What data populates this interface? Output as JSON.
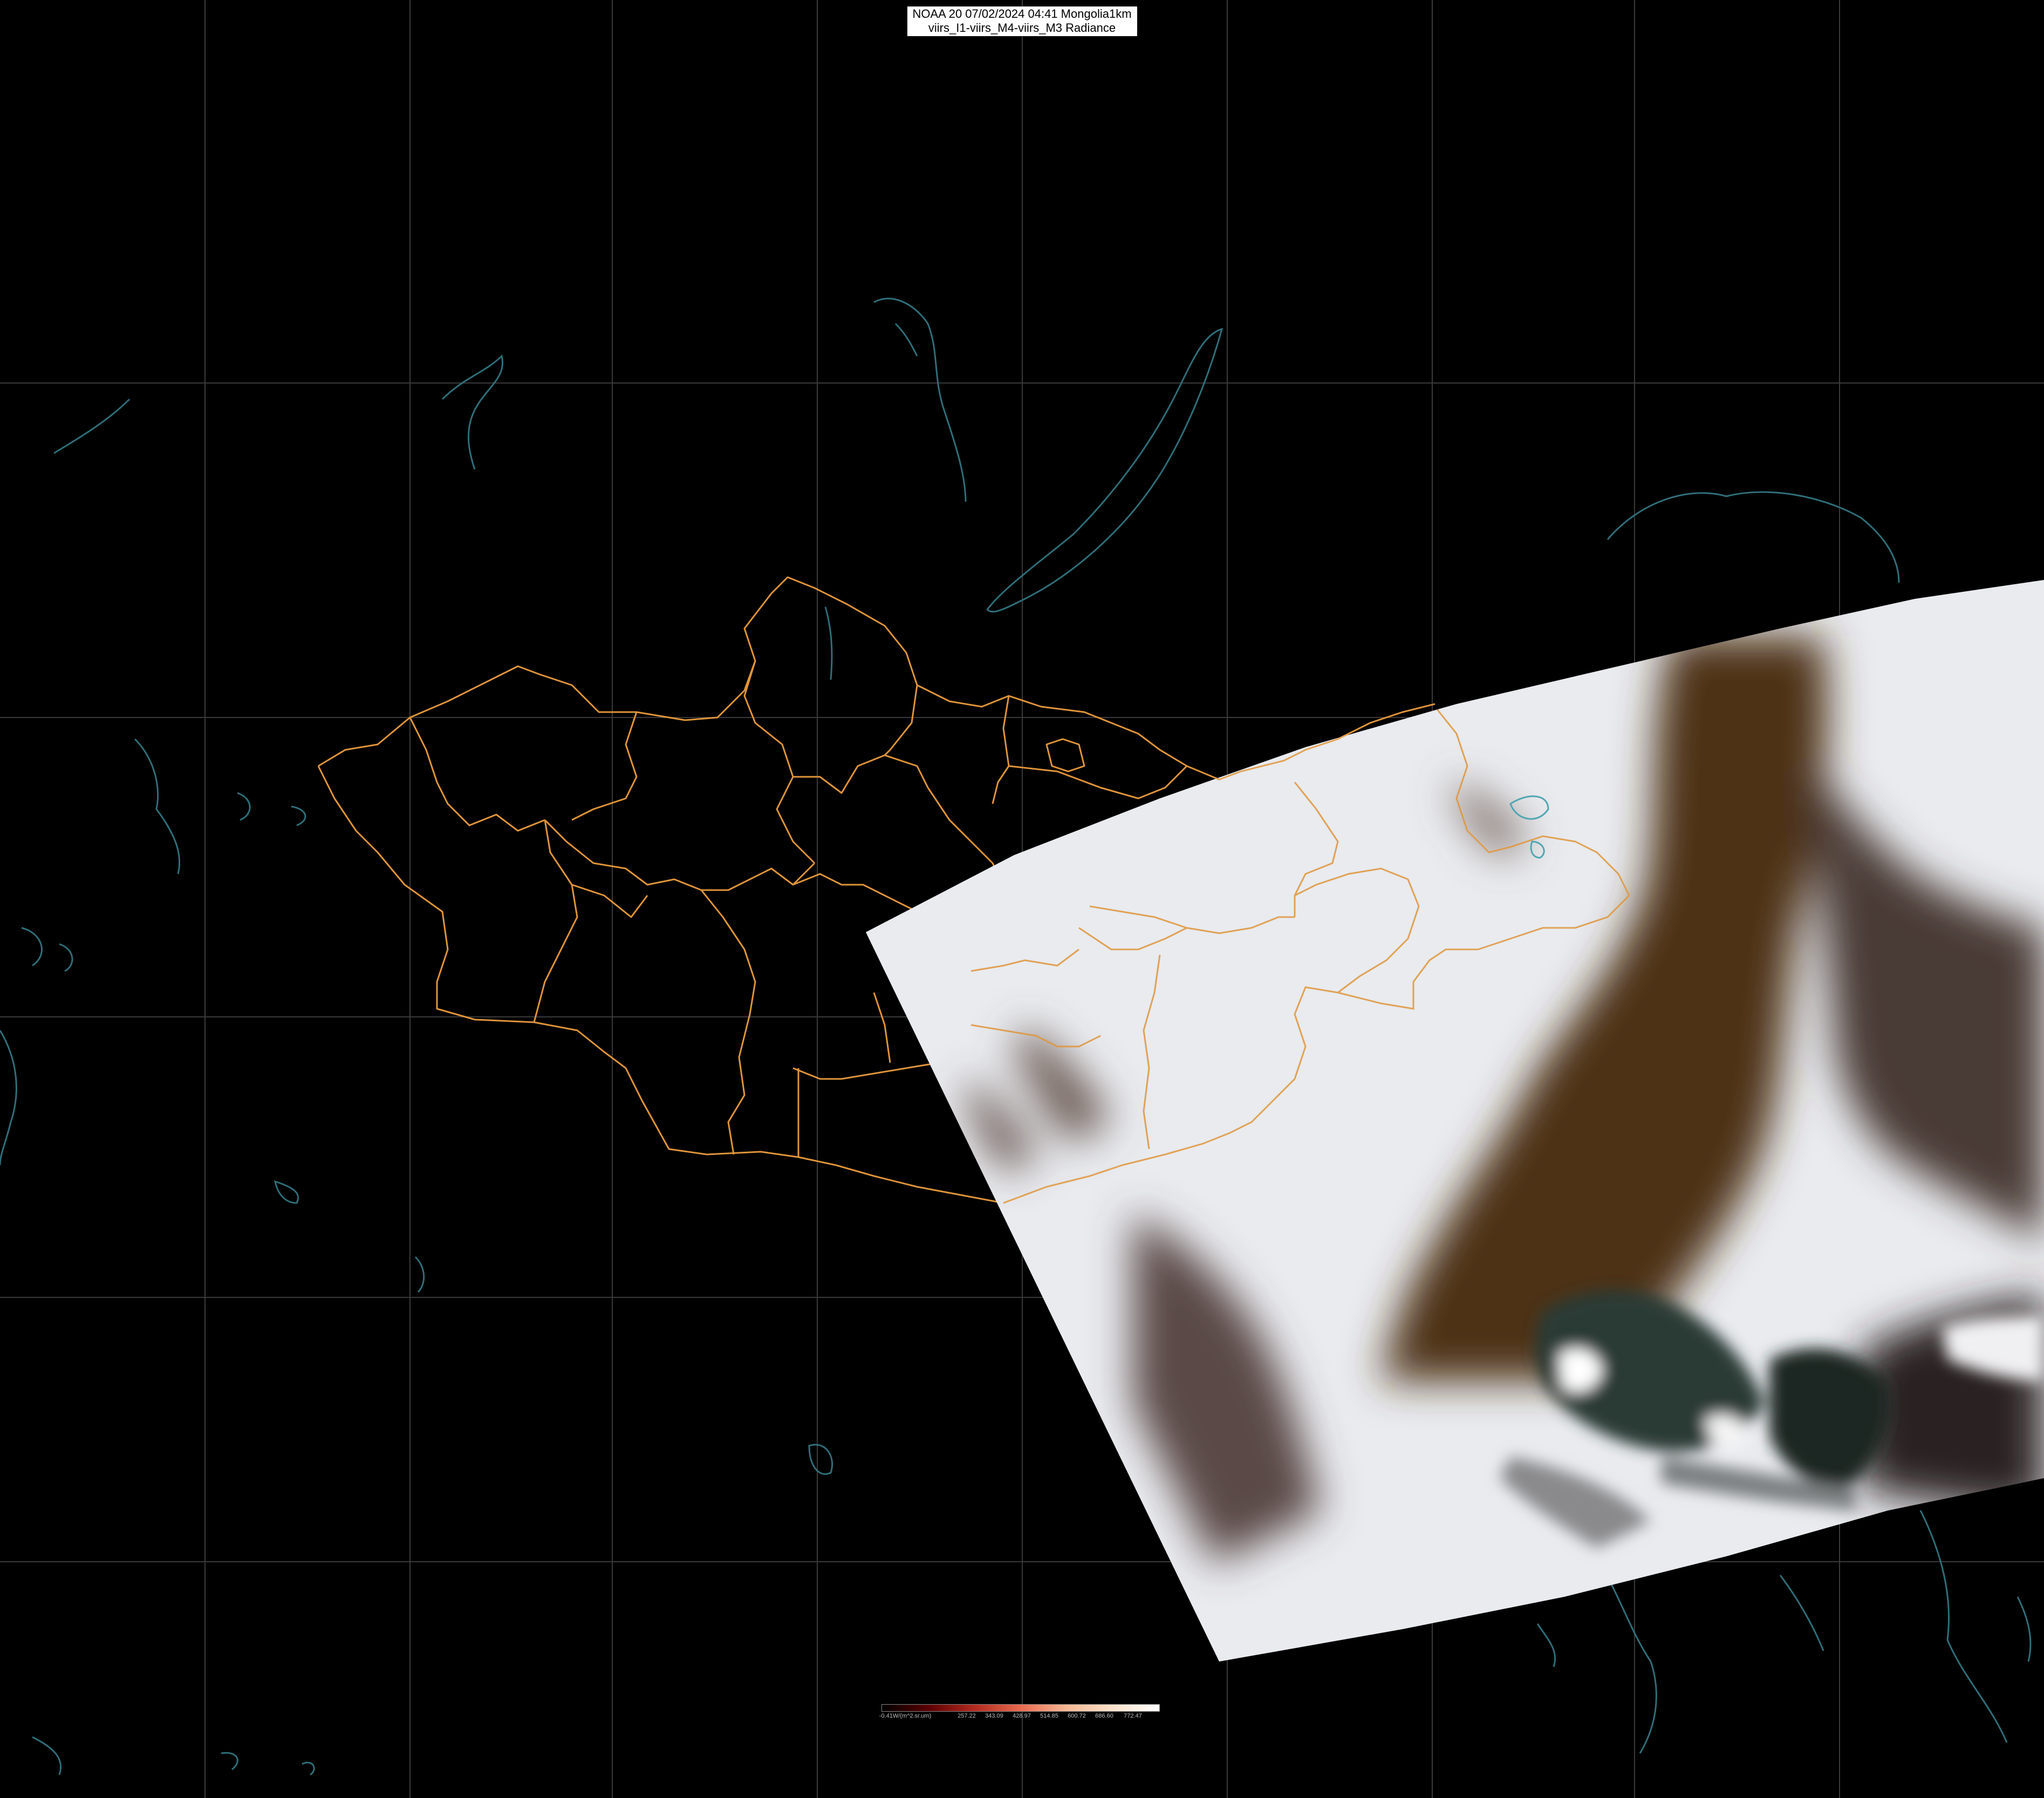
{
  "header": {
    "title_line1": "NOAA 20 07/02/2024 04:41 Mongolia1km",
    "title_line2": "viirs_I1-viirs_M4-viirs_M3 Radiance"
  },
  "colorbar": {
    "tick_labels": [
      "-0.41W/(m^2.sr.um)",
      "257.22",
      "343.09",
      "428.97",
      "514.85",
      "600.72",
      "686.60",
      "772.47"
    ],
    "ramp_colors": [
      "#000000",
      "#5a0000",
      "#b22a1f",
      "#e86a4e",
      "#f5b894",
      "#fbe3cc",
      "#ffffff"
    ]
  },
  "colors": {
    "background": "#000000",
    "graticule": "#3a3a3a",
    "province_borders": "#e0953a",
    "coastlines_lakes": "#2f6f7a",
    "snow": "#eef0f4",
    "bare_land": "#5a3a22",
    "sea": "#1e2a2a"
  },
  "layers": {
    "basemap": "graticule-and-coastlines",
    "boundaries": "mongolia-aimag-borders",
    "imagery": "viirs-swath-true-color"
  }
}
